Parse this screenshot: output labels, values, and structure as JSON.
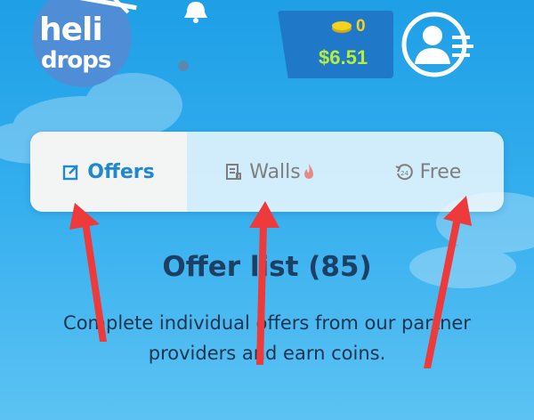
{
  "logo": {
    "line1": "heli",
    "line2": "drops"
  },
  "wallet": {
    "coins": "0",
    "cash": "$6.51"
  },
  "tabs": [
    {
      "label": "Offers",
      "icon": "edit-square-icon",
      "active": true
    },
    {
      "label": "Walls",
      "icon": "receipt-icon",
      "badge_icon": "fire-icon",
      "active": false
    },
    {
      "label": "Free",
      "icon": "refresh-24-icon",
      "active": false
    }
  ],
  "main": {
    "title": "Offer list (85)",
    "description": "Complete individual offers from our partner providers and earn coins."
  },
  "colors": {
    "background": "#1e9fe6",
    "active_tab_text": "#1f88cf",
    "inactive_tab_text": "#7e7e7e",
    "coin": "#f4d21f",
    "cash": "#b7ee3c",
    "arrow": "#ee3a3a",
    "title": "#1d3f63"
  }
}
